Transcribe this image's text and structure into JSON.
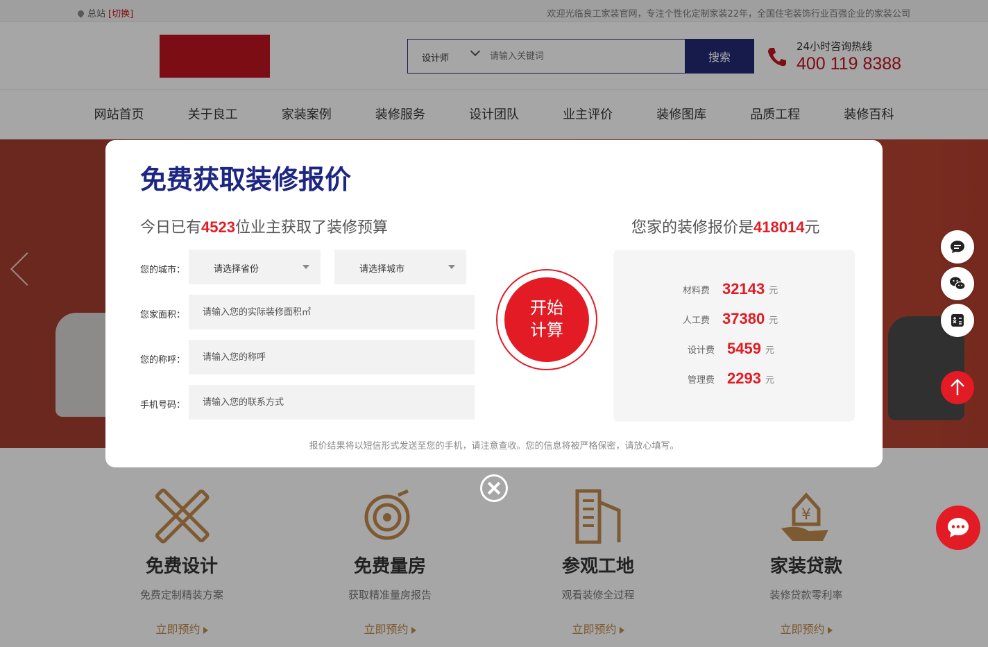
{
  "topbar": {
    "location": "总站",
    "switch_label": "[切换]",
    "welcome": "欢迎光临良工家装官网，专注个性化定制家装22年，全国住宅装饰行业百强企业的家装公司"
  },
  "header": {
    "search_category": "设计师",
    "search_placeholder": "请输入关键词",
    "search_button": "搜索",
    "hotline_label": "24小时咨询热线",
    "hotline_number": "400 119 8388"
  },
  "nav": {
    "items": [
      "网站首页",
      "关于良工",
      "家装案例",
      "装修服务",
      "设计团队",
      "业主评价",
      "装修图库",
      "品质工程",
      "装修百科"
    ]
  },
  "features": [
    {
      "title": "免费设计",
      "desc": "免费定制精装方案",
      "link": "立即预约"
    },
    {
      "title": "免费量房",
      "desc": "获取精准量房报告",
      "link": "立即预约"
    },
    {
      "title": "参观工地",
      "desc": "观看装修全过程",
      "link": "立即预约"
    },
    {
      "title": "家装贷款",
      "desc": "装修贷款零利率",
      "link": "立即预约"
    }
  ],
  "modal": {
    "title": "免费获取装修报价",
    "sub_prefix": "今日已有",
    "sub_count": "4523",
    "sub_suffix": "位业主获取了装修预算",
    "city_label": "您的城市：",
    "province_placeholder": "请选择省份",
    "city_placeholder": "请选择城市",
    "area_label": "您家面积：",
    "area_placeholder": "请输入您的实际装修面积㎡",
    "name_label": "您的称呼：",
    "name_placeholder": "请输入您的称呼",
    "phone_label": "手机号码：",
    "phone_placeholder": "请输入您的联系方式",
    "calc_line1": "开始",
    "calc_line2": "计算",
    "result_prefix": "您家的装修报价是",
    "result_total": "418014",
    "result_suffix": "元",
    "result_items": [
      {
        "label": "材料费",
        "value": "32143",
        "unit": "元"
      },
      {
        "label": "人工费",
        "value": "37380",
        "unit": "元"
      },
      {
        "label": "设计费",
        "value": "5459",
        "unit": "元"
      },
      {
        "label": "管理费",
        "value": "2293",
        "unit": "元"
      }
    ],
    "notice": "报价结果将以短信形式发送至您的手机，请注意查收。您的信息将被严格保密，请放心填写。"
  },
  "colors": {
    "brand_red": "#e21b25",
    "nav_blue": "#222a73",
    "title_blue": "#1d2680",
    "gold": "#c08a4c"
  },
  "icons": [
    "location-pin-icon",
    "chevron-down-icon",
    "phone-icon",
    "ruler-pencil-icon",
    "target-icon",
    "building-icon",
    "yen-hand-icon",
    "close-icon",
    "message-icon",
    "wechat-icon",
    "calculator-icon",
    "arrow-up-icon",
    "chat-icon"
  ]
}
